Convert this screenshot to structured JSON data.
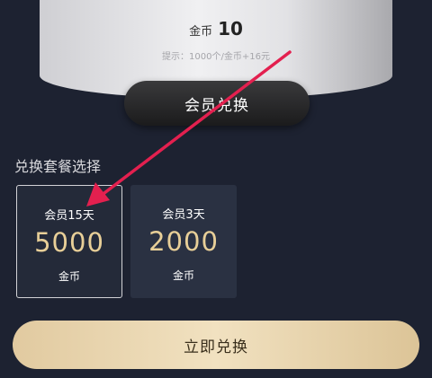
{
  "balance": {
    "label": "金币",
    "value": "10",
    "hint": "提示：1000个/金币+16元"
  },
  "member_exchange_button": "会员兑换",
  "section_title": "兑换套餐选择",
  "packages": [
    {
      "name": "会员15天",
      "price": "5000",
      "unit": "金币",
      "selected": true
    },
    {
      "name": "会员3天",
      "price": "2000",
      "unit": "金币",
      "selected": false
    }
  ],
  "redeem_button": "立即兑换",
  "colors": {
    "background": "#1d2231",
    "price_gold": "#e8cf98",
    "annotation_arrow": "#e3204f"
  }
}
